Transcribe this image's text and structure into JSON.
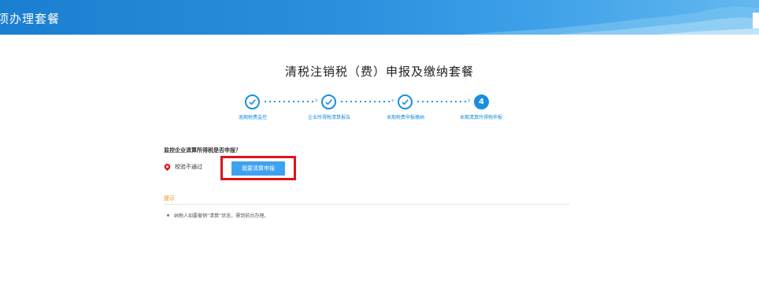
{
  "header": {
    "title": "项办理套餐"
  },
  "page": {
    "title": "清税注销税（费）申报及缴纳套餐"
  },
  "steps": [
    {
      "label": "逾期税费监控",
      "state": "done"
    },
    {
      "label": "企业所得税清算报告",
      "state": "done"
    },
    {
      "label": "本期税费申报缴纳",
      "state": "done"
    },
    {
      "label": "本期清算所得税申报",
      "state": "active",
      "number": "4"
    }
  ],
  "check": {
    "question": "监控企业清算所得税是否申报？",
    "status_text": "校验不通过",
    "button_label": "我要清算申报"
  },
  "tips": {
    "title": "提示",
    "items": [
      "纳税人如要撤销“清算”状态，需到前台办理。"
    ]
  },
  "colors": {
    "primary": "#1a8fe0",
    "error": "#e0141c",
    "tip": "#f08a1f"
  }
}
